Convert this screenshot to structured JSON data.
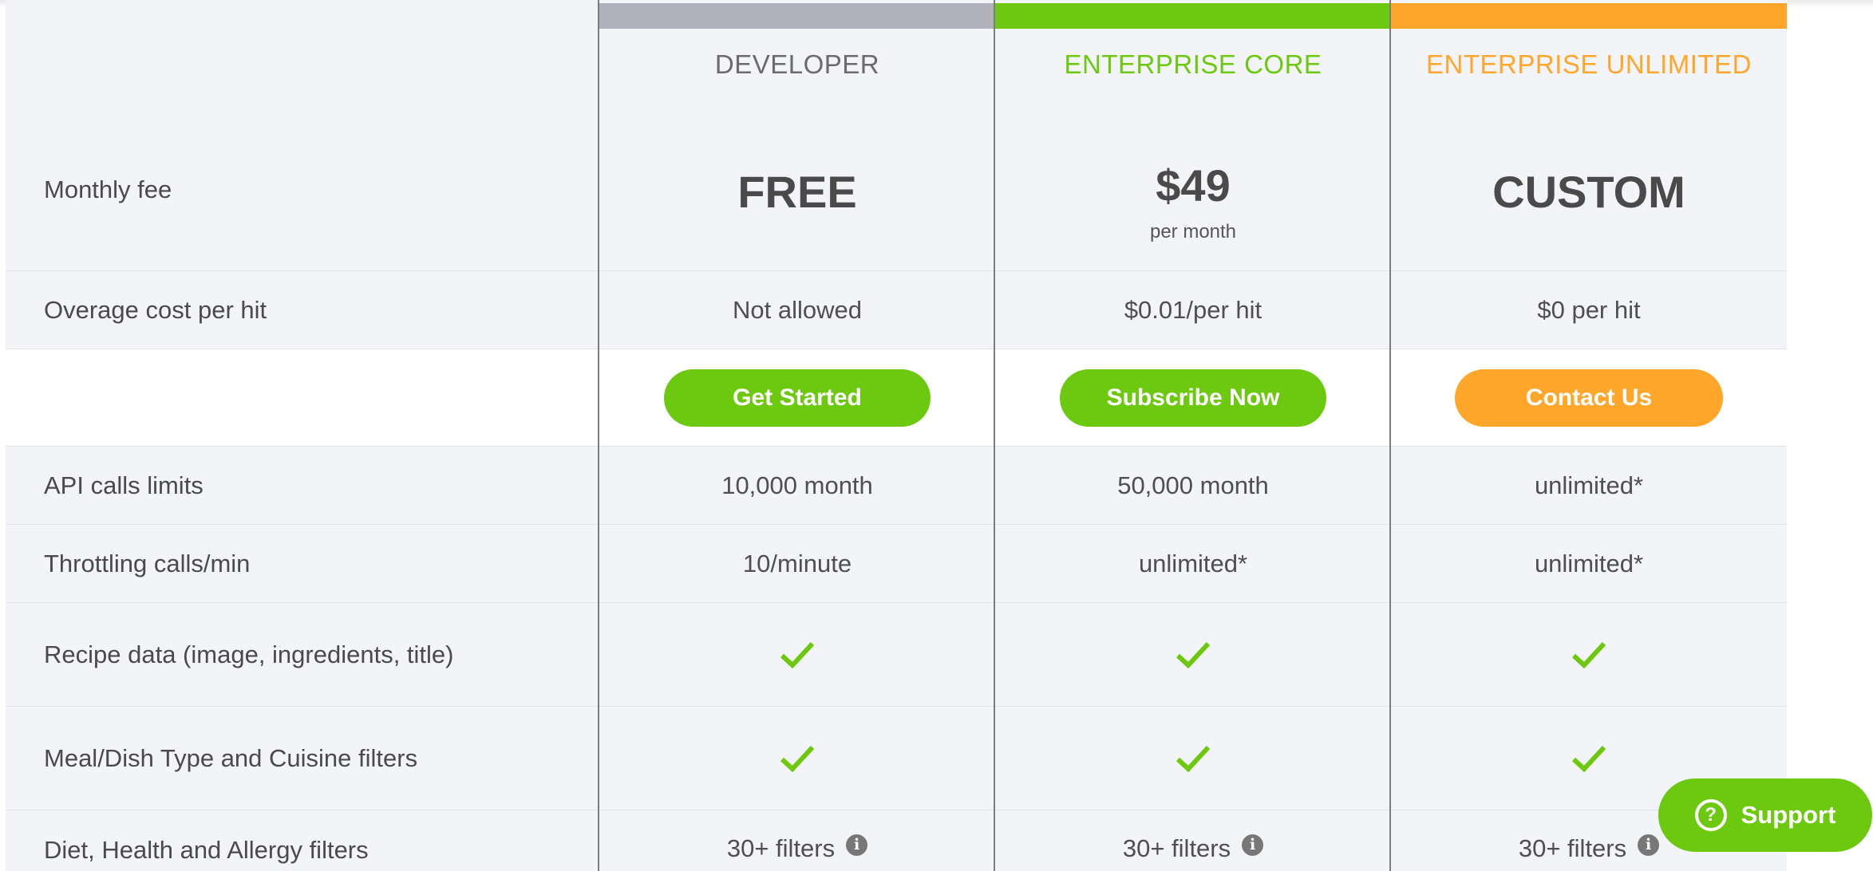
{
  "colors": {
    "developer": "#b1b2bc",
    "core": "#6cc90f",
    "unlimited": "#ffa62b",
    "check": "#6cc90f"
  },
  "labels": {
    "monthly_fee": "Monthly fee",
    "overage": "Overage cost per hit",
    "api_limits": "API calls limits",
    "throttling": "Throttling calls/min",
    "recipe": "Recipe data (image, ingredients, title)",
    "meal": "Meal/Dish Type and Cuisine filters",
    "diet": "Diet, Health and Allergy filters"
  },
  "plans": {
    "developer": {
      "name": "DEVELOPER",
      "price": "FREE",
      "overage": "Not allowed",
      "button": "Get Started",
      "api_limits": "10,000 month",
      "throttling": "10/minute",
      "diet": "30+ filters"
    },
    "core": {
      "name": "ENTERPRISE CORE",
      "price": "$49",
      "price_sub": "per month",
      "overage": "$0.01/per hit",
      "button": "Subscribe Now",
      "api_limits": "50,000 month",
      "throttling": "unlimited*",
      "diet": "30+ filters"
    },
    "unlimited": {
      "name": "ENTERPRISE UNLIMITED",
      "price": "CUSTOM",
      "overage": "$0 per hit",
      "button": "Contact Us",
      "api_limits": "unlimited*",
      "throttling": "unlimited*",
      "diet": "30+ filters"
    }
  },
  "icons": {
    "check": "check-icon",
    "info": "info-icon",
    "support": "question-circle-icon"
  },
  "info_glyph": "i",
  "support": {
    "icon_glyph": "?",
    "label": "Support"
  }
}
